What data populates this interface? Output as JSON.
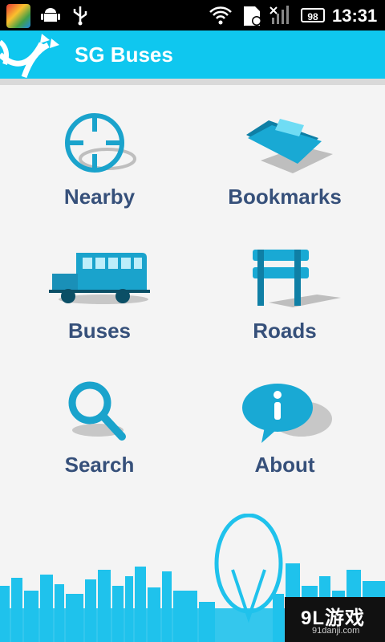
{
  "status_bar": {
    "battery": "98",
    "time": "13:31",
    "icons": [
      "app-icon",
      "android-icon",
      "usb-icon",
      "wifi-icon",
      "sd-card-icon",
      "no-signal-icon",
      "battery-icon"
    ]
  },
  "action_bar": {
    "title": "SG Buses",
    "accent_color": "#0fc7ef"
  },
  "menu": {
    "items": [
      {
        "label": "Nearby",
        "icon": "crosshair-icon"
      },
      {
        "label": "Bookmarks",
        "icon": "folder-icon"
      },
      {
        "label": "Buses",
        "icon": "bus-icon"
      },
      {
        "label": "Roads",
        "icon": "road-sign-icon"
      },
      {
        "label": "Search",
        "icon": "magnifier-icon"
      },
      {
        "label": "About",
        "icon": "info-bubble-icon"
      }
    ],
    "label_color": "#36507a",
    "icon_color": "#1aa3cc"
  },
  "watermark": {
    "main": "9L游戏",
    "sub": "91danji.com"
  }
}
